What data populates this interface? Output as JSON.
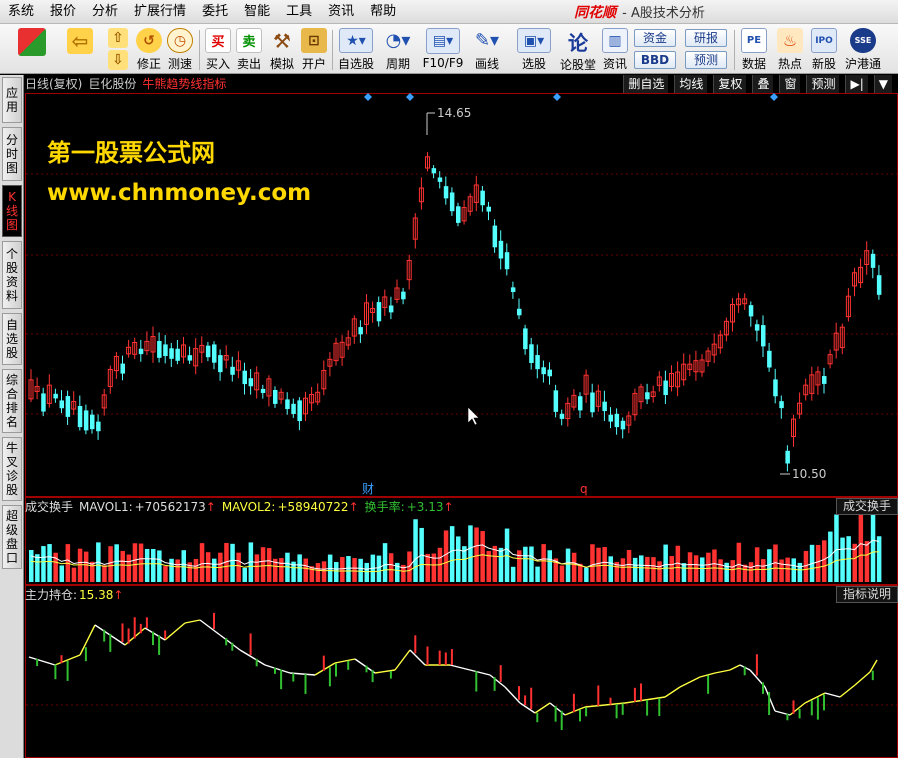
{
  "menu": [
    "系统",
    "报价",
    "分析",
    "扩展行情",
    "委托",
    "智能",
    "工具",
    "资讯",
    "帮助"
  ],
  "brand": "同花顺",
  "app_title": "- A股技术分析",
  "toolbar": {
    "buttons": [
      {
        "label": "",
        "icon": "layout-grid-icon",
        "glyph": "▦"
      },
      {
        "label": "",
        "icon": "back-arrow-icon",
        "glyph": "⇦"
      },
      {
        "label": "",
        "icon": "up-down-arrows-icon",
        "glyph": "⇧"
      },
      {
        "label": "修正",
        "icon": "fix-icon",
        "glyph": "↺"
      },
      {
        "label": "测速",
        "icon": "speed-clock-icon",
        "glyph": "◷"
      },
      {
        "label": "买入",
        "icon": "buy-icon",
        "glyph": "买"
      },
      {
        "label": "卖出",
        "icon": "sell-icon",
        "glyph": "卖"
      },
      {
        "label": "模拟",
        "icon": "hammer-icon",
        "glyph": "⚒"
      },
      {
        "label": "开户",
        "icon": "lock-icon",
        "glyph": "⊡"
      },
      {
        "label": "自选股",
        "icon": "star-list-icon",
        "glyph": "★"
      },
      {
        "label": "周期",
        "icon": "clock-icon",
        "glyph": "◔"
      },
      {
        "label": "F10/F9",
        "icon": "f10-icon",
        "glyph": "▤"
      },
      {
        "label": "画线",
        "icon": "pen-icon",
        "glyph": "✎"
      },
      {
        "label": "选股",
        "icon": "select-stock-icon",
        "glyph": "▣"
      },
      {
        "label": "论股堂",
        "icon": "forum-icon",
        "glyph": "论"
      },
      {
        "label": "资讯",
        "icon": "news-icon",
        "glyph": "▥"
      },
      {
        "label": "数据",
        "icon": "pe-data-icon",
        "glyph": "PE"
      },
      {
        "label": "热点",
        "icon": "hot-icon",
        "glyph": "♨"
      },
      {
        "label": "新股",
        "icon": "ipo-icon",
        "glyph": "IPO"
      },
      {
        "label": "沪港通",
        "icon": "sse-hke-icon",
        "glyph": "SSE"
      }
    ],
    "pills": [
      "资金",
      "BBD",
      "研报",
      "预测"
    ]
  },
  "side_tabs": [
    "应用",
    "分时图",
    "K线图",
    "个股资料",
    "自选股",
    "综合排名",
    "牛叉诊股",
    "超级盘口"
  ],
  "kline": {
    "period": "日线(复权)",
    "stock": "巨化股份",
    "indicator": "牛熊趋势线指标",
    "right_buttons": [
      "删自选",
      "均线",
      "复权",
      "叠",
      "窗",
      "预测",
      "▶|",
      "▼"
    ],
    "high_label": "14.65",
    "low_label": "10.50",
    "marker_cai": "财",
    "marker_q": "q",
    "colors": {
      "up": "#ff3232",
      "down": "#54ffff",
      "grid": "#6a0000",
      "border": "#a00000"
    }
  },
  "watermark": {
    "line1": "第一股票公式网",
    "line2": "www.chnmoney.com"
  },
  "volume": {
    "title": "成交换手",
    "mavol1_label": "MAVOL1:",
    "mavol1_value": "+70562173",
    "mavol2_label": "MAVOL2:",
    "mavol2_value": "+58940722",
    "turnover_label": "换手率:",
    "turnover_value": "+3.13",
    "up_arrow": "↑",
    "tag_button": "成交换手"
  },
  "indicator": {
    "title": "主力持仓:",
    "value": "15.38",
    "up_arrow": "↑",
    "tag_button": "指标说明"
  }
}
